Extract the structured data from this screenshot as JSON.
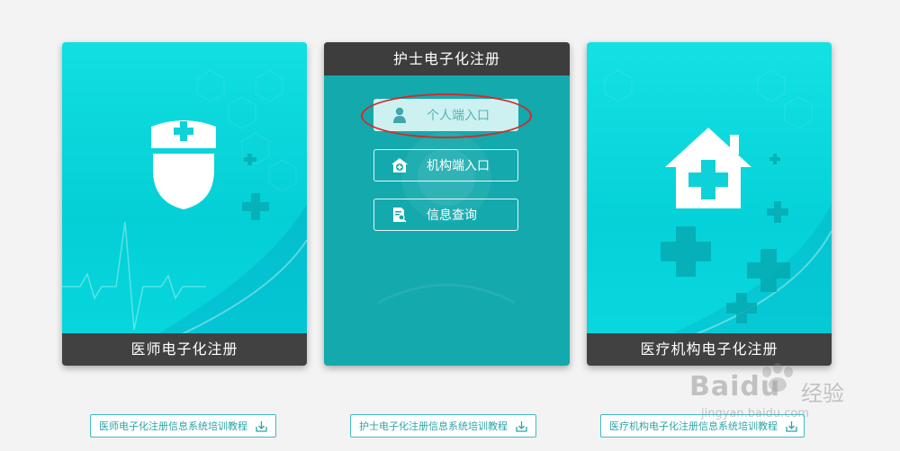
{
  "cards": {
    "doctor": {
      "label": "医师电子化注册"
    },
    "nurse": {
      "title": "护士电子化注册",
      "buttons": [
        {
          "label": "个人端入口",
          "icon": "person-icon",
          "active": true
        },
        {
          "label": "机构端入口",
          "icon": "hospital-icon",
          "active": false
        },
        {
          "label": "信息查询",
          "icon": "document-search-icon",
          "active": false
        }
      ]
    },
    "org": {
      "label": "医疗机构电子化注册"
    }
  },
  "downloads": [
    {
      "label": "医师电子化注册信息系统培训教程",
      "icon": "download-icon"
    },
    {
      "label": "护士电子化注册信息系统培训教程",
      "icon": "download-icon"
    },
    {
      "label": "医疗机构电子化注册信息系统培训教程",
      "icon": "download-icon"
    }
  ],
  "watermark": {
    "brand": "Baidu",
    "cn": "经验",
    "url": "jingyan.baidu.com"
  },
  "colors": {
    "accent": "#13a9ad",
    "cyan": "#08d8df",
    "dark": "#414141",
    "highlight": "#d42a2a"
  }
}
